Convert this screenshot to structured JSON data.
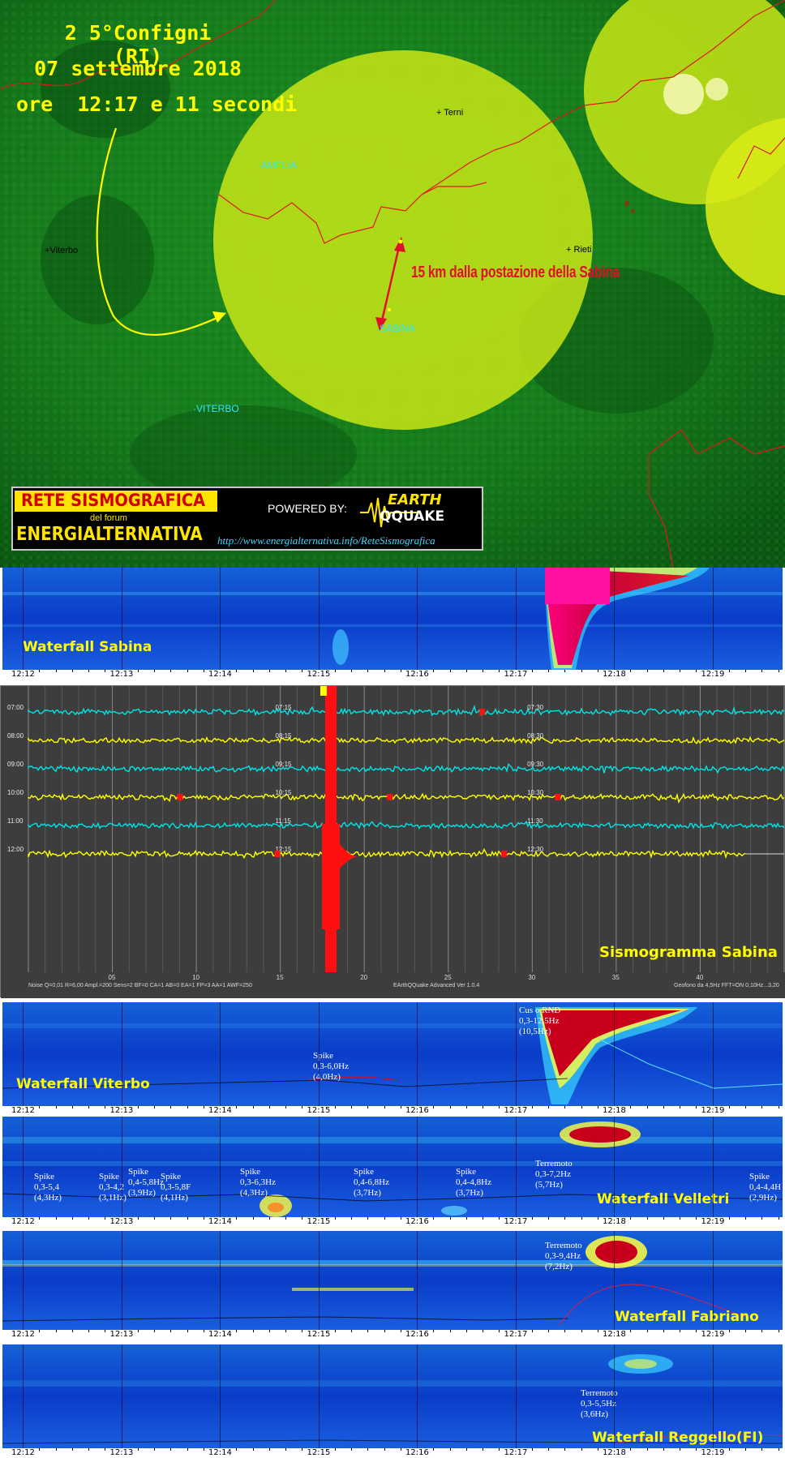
{
  "map": {
    "title_line1": "2 5°Configni (RI)",
    "title_line2": "07 settembre 2018",
    "title_line3": "ore  12:17 e 11 secondi",
    "distance_label": "15 km dalla postazione della Sabina",
    "places": [
      {
        "name": "Terni",
        "style": "black"
      },
      {
        "name": "Viterbo",
        "style": "black"
      },
      {
        "name": "Rieti",
        "style": "black"
      },
      {
        "name": "AMELIA",
        "style": "cyan"
      },
      {
        "name": "SABINA",
        "style": "cyan"
      },
      {
        "name": "VITERBO",
        "style": "cyan"
      }
    ],
    "banner": {
      "line1": "RETE SISMOGRAFICA",
      "line2": "del forum",
      "line3": "ENERGIALTERNATIVA",
      "powered": "POWERED BY:",
      "logo_top": "EARTH",
      "logo_bottom": "QQUAKE",
      "url": "http://www.energialternativa.info/ReteSismografica"
    }
  },
  "time_ticks": [
    "12:12",
    "12:13",
    "12:14",
    "12:15",
    "12:16",
    "12:17",
    "12:18",
    "12:19"
  ],
  "waterfalls": {
    "sabina": {
      "label": "Waterfall Sabina"
    },
    "viterbo": {
      "label": "Waterfall Viterbo",
      "annotations": [
        {
          "lines": [
            "Spike",
            "0,3-6,0Hz",
            "(4,0Hz)"
          ]
        },
        {
          "lines": [
            "Cus o RND",
            "0,3-12,5Hz",
            "(10,5Hz)"
          ]
        }
      ]
    },
    "velletri": {
      "label": "Waterfall Velletri",
      "annotations": [
        {
          "lines": [
            "Spike",
            "0,3-5,4",
            "(4,3Hz)"
          ]
        },
        {
          "lines": [
            "Spike",
            "0,3-4,2",
            "(3,1Hz)"
          ]
        },
        {
          "lines": [
            "Spike",
            "0,4-5,8Hz",
            "(3,9Hz)"
          ]
        },
        {
          "lines": [
            "Spike",
            "0,3-5,8F",
            "(4,1Hz)"
          ]
        },
        {
          "lines": [
            "Spike",
            "0,3-6,3Hz",
            "(4,3Hz)"
          ]
        },
        {
          "lines": [
            "Spike",
            "0,4-6,8Hz",
            "(3,7Hz)"
          ]
        },
        {
          "lines": [
            "Spike",
            "0,4-4,8Hz",
            "(3,7Hz)"
          ]
        },
        {
          "lines": [
            "Terremoto",
            "0,3-7,2Hz",
            "(5,7Hz)"
          ]
        },
        {
          "lines": [
            "Spike",
            "0,4-4,4H",
            "(2,9Hz)"
          ]
        }
      ]
    },
    "fabriano": {
      "label": "Waterfall Fabriano",
      "annotations": [
        {
          "lines": [
            "Terremoto",
            "0,3-9,4Hz",
            "(7,2Hz)"
          ]
        }
      ]
    },
    "reggello": {
      "label": "Waterfall Reggello(FI)",
      "annotations": [
        {
          "lines": [
            "Terremoto",
            "0,3-5,5Hz",
            "(3,6Hz)"
          ]
        }
      ]
    }
  },
  "seismogram": {
    "label": "Sismogramma Sabina",
    "rows": [
      {
        "hour": "07:00",
        "mid": "07:15",
        "late": "07:30",
        "color": "#00e5e5"
      },
      {
        "hour": "08:00",
        "mid": "08:15",
        "late": "08:30",
        "color": "#ffff00"
      },
      {
        "hour": "09:00",
        "mid": "09:15",
        "late": "09:30",
        "color": "#00e5e5"
      },
      {
        "hour": "10:00",
        "mid": "10:15",
        "late": "10:30",
        "color": "#ffff00"
      },
      {
        "hour": "11:00",
        "mid": "11:15",
        "late": "11:30",
        "color": "#00e5e5"
      },
      {
        "hour": "12:00",
        "mid": "12:15",
        "late": "12:30",
        "color": "#ffff00"
      }
    ],
    "minute_ticks": [
      "05",
      "10",
      "15",
      "20",
      "25",
      "30",
      "35",
      "40"
    ],
    "footer_left": "Noise Q=0,01 R=6,00 Ampl.=200 Sens=2 BF=0 CA=1 AB=0 EA=1 FP=3 AA=1 AWF=250",
    "footer_mid": "EArthQQuake Advanced Ver 1.0.4",
    "footer_right": "Geofono da 4,5Hz FFT=ON 0,10Hz...3,20"
  }
}
